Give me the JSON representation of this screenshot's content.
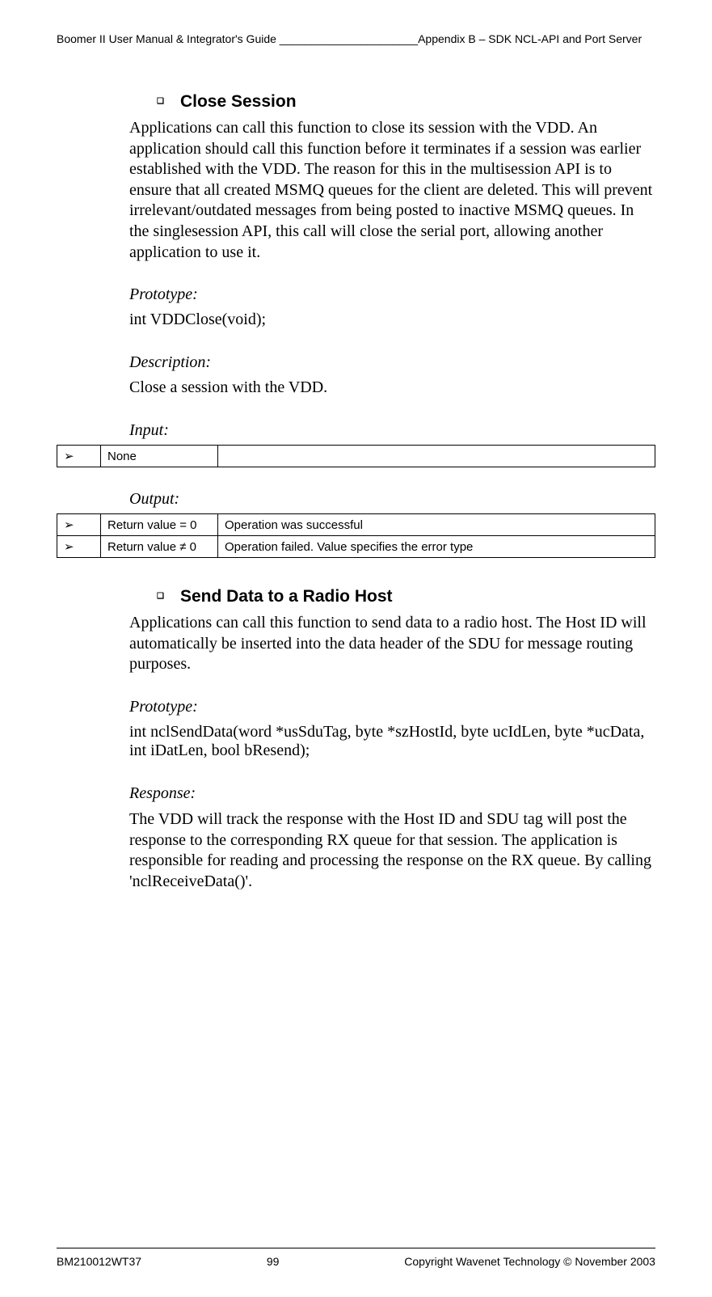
{
  "header": {
    "left": "Boomer II User Manual & Integrator's Guide ______________________Appendix B – SDK NCL-API and Port Server"
  },
  "section1": {
    "title": "Close Session",
    "body": "Applications can call this function to close its session with the VDD. An application should call this function before it terminates if a session was earlier established with the VDD.  The reason for this in the multisession API is to ensure that all created MSMQ queues for the client are deleted. This will prevent irrelevant/outdated messages from being posted to inactive MSMQ queues.  In the singlesession API, this call will close the serial port, allowing another application to use it.",
    "proto_label": "Prototype:",
    "proto": "int VDDClose(void);",
    "desc_label": "Description:",
    "desc": "Close a session with the VDD.",
    "input_label": "Input:",
    "input_table": {
      "rows": [
        {
          "arrow": "➢",
          "c1": "None",
          "c2": ""
        }
      ]
    },
    "output_label": "Output:",
    "output_table": {
      "rows": [
        {
          "arrow": "➢",
          "c1": "Return value = 0",
          "c2": "Operation was successful"
        },
        {
          "arrow": "➢",
          "c1": "Return value  ≠ 0",
          "c2": "Operation failed. Value specifies the error type"
        }
      ]
    }
  },
  "section2": {
    "title": "Send Data to a Radio Host",
    "body": "Applications can call this function to send data to a radio host. The Host ID will automatically be inserted into the data header of the SDU for message routing purposes.",
    "proto_label": "Prototype:",
    "proto": "int nclSendData(word *usSduTag, byte *szHostId, byte ucIdLen, byte *ucData, int iDatLen, bool bResend);",
    "resp_label": "Response:",
    "resp": "The VDD will track the response with the Host ID and SDU tag will post the response to the corresponding RX queue for that session. The application is responsible for reading and processing the response on the RX queue. By calling 'nclReceiveData()'."
  },
  "footer": {
    "left": "BM210012WT37",
    "center": "99",
    "right": "Copyright Wavenet Technology © November 2003"
  }
}
